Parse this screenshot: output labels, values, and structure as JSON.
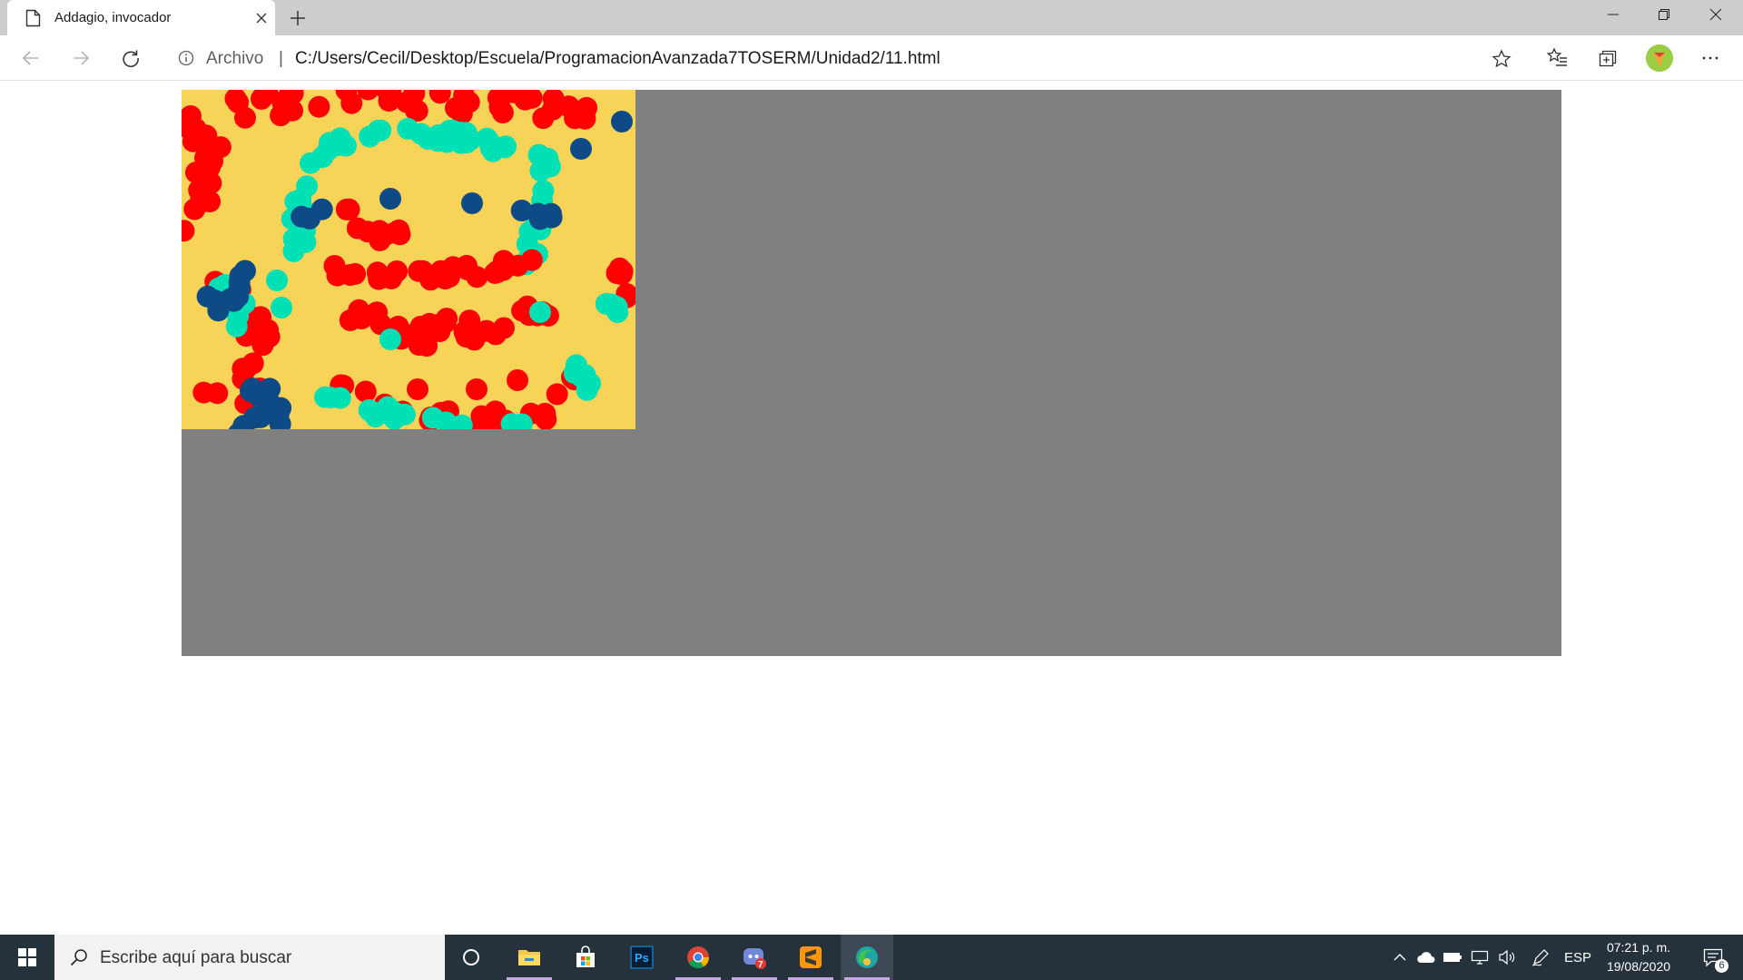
{
  "browser": {
    "tab": {
      "title": "Addagio, invocador"
    },
    "omnibox": {
      "site_info_label": "Archivo",
      "separator": "|",
      "url": "C:/Users/Cecil/Desktop/Escuela/ProgramacionAvanzada7TOSERM/Unidad2/11.html"
    },
    "icons": [
      "page-icon",
      "close-icon",
      "plus-icon",
      "minimize-icon",
      "restore-icon",
      "close-window-icon",
      "back-arrow-icon",
      "forward-arrow-icon",
      "refresh-icon",
      "info-icon",
      "star-icon",
      "favorites-icon",
      "collections-icon",
      "more-icon"
    ]
  },
  "page": {
    "colors": {
      "stage": "#808080",
      "canvas_bg": "#f7d358",
      "dot_red": "#ff0000",
      "dot_teal": "#00e0b5",
      "dot_navy": "#0e4a85"
    }
  },
  "taskbar": {
    "search_placeholder": "Escribe aquí para buscar",
    "apps": [
      "task-view-icon",
      "file-explorer-icon",
      "store-icon",
      "photoshop-icon",
      "chrome-icon",
      "discord-icon",
      "sublime-text-icon",
      "edge-icon"
    ],
    "photoshop_label": "Ps",
    "discord_badge": "7",
    "tray": {
      "language": "ESP",
      "time": "07:21 p. m.",
      "date": "19/08/2020",
      "notification_count": "6"
    }
  }
}
